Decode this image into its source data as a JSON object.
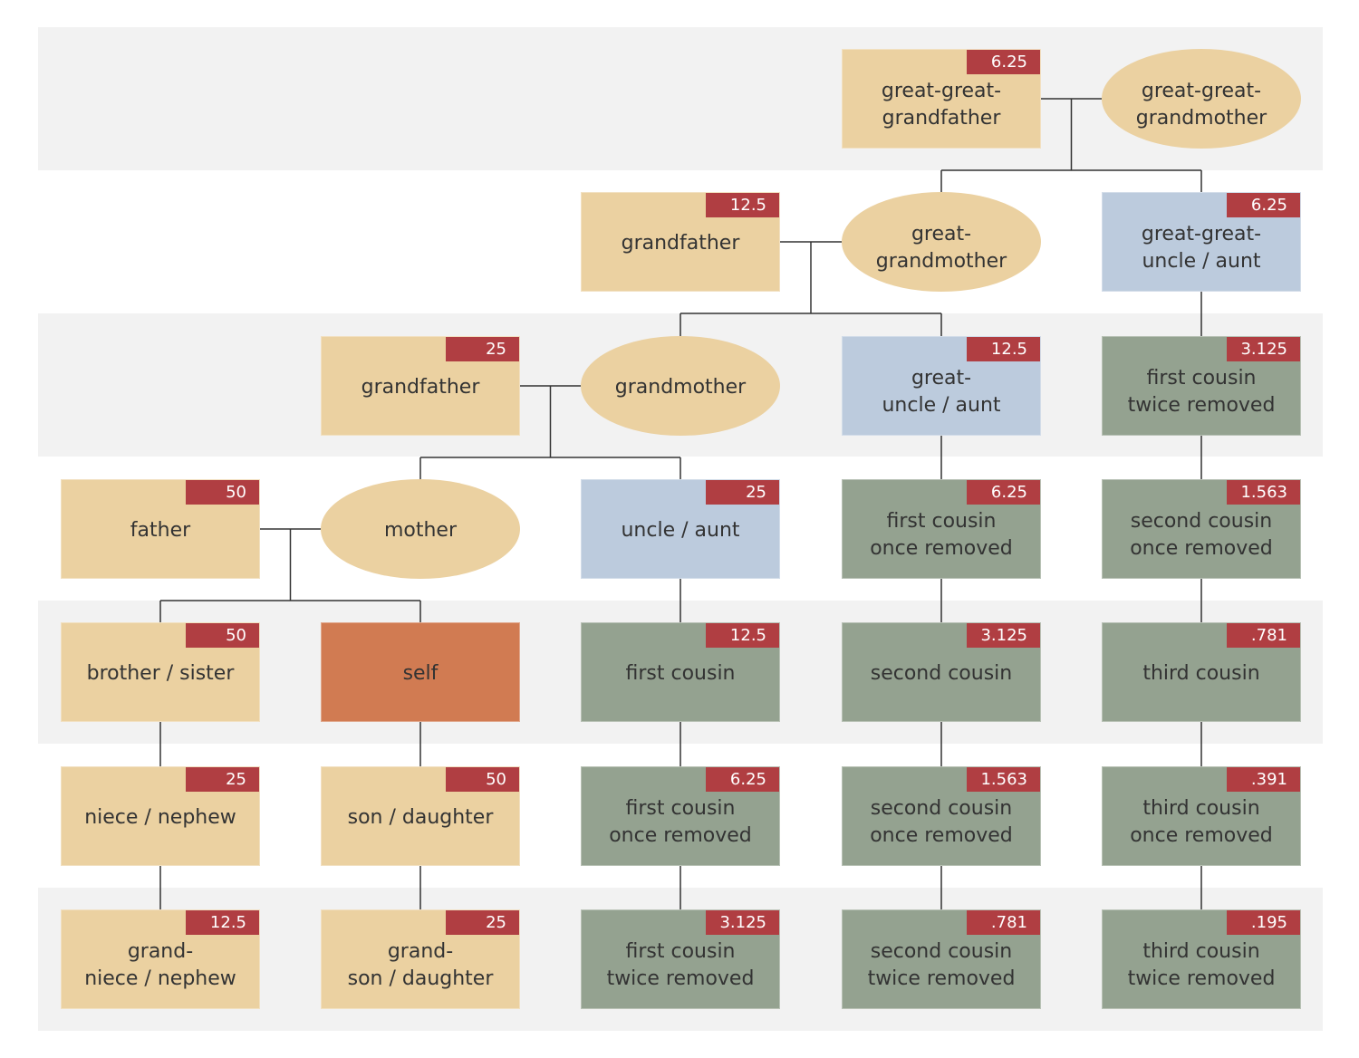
{
  "colors": {
    "ancestor": "#ebd1a1",
    "sibling_line": "#ebd1a1",
    "uncle_aunt": "#bccbdd",
    "cousin": "#94a290",
    "self": "#d17b52",
    "badge": "#b03e42",
    "band": "#f2f2f2",
    "line": "#333333"
  },
  "nodes": [
    {
      "id": "ggf",
      "label": "great-great-\ngrandfather",
      "badge": "6.25",
      "kind": "ancestor",
      "shape": "rect",
      "col": 3,
      "row": 0
    },
    {
      "id": "ggm",
      "label": "great-great-\ngrandmother",
      "badge": null,
      "kind": "ancestor",
      "shape": "ellipse",
      "col": 4,
      "row": 0
    },
    {
      "id": "gf2",
      "label": "grandfather",
      "badge": "12.5",
      "kind": "ancestor",
      "shape": "rect",
      "col": 2,
      "row": 1
    },
    {
      "id": "ggm2",
      "label": "great-\ngrandmother",
      "badge": null,
      "kind": "ancestor",
      "shape": "ellipse",
      "col": 3,
      "row": 1
    },
    {
      "id": "ggua",
      "label": "great-great-\nuncle / aunt",
      "badge": "6.25",
      "kind": "uncle_aunt",
      "shape": "rect",
      "col": 4,
      "row": 1
    },
    {
      "id": "gf",
      "label": "grandfather",
      "badge": "25",
      "kind": "ancestor",
      "shape": "rect",
      "col": 1,
      "row": 2
    },
    {
      "id": "gm",
      "label": "grandmother",
      "badge": null,
      "kind": "ancestor",
      "shape": "ellipse",
      "col": 2,
      "row": 2
    },
    {
      "id": "gua",
      "label": "great-\nuncle / aunt",
      "badge": "12.5",
      "kind": "uncle_aunt",
      "shape": "rect",
      "col": 3,
      "row": 2
    },
    {
      "id": "fc2r_a",
      "label": "first cousin\ntwice removed",
      "badge": "3.125",
      "kind": "cousin",
      "shape": "rect",
      "col": 4,
      "row": 2
    },
    {
      "id": "father",
      "label": "father",
      "badge": "50",
      "kind": "ancestor",
      "shape": "rect",
      "col": 0,
      "row": 3
    },
    {
      "id": "mother",
      "label": "mother",
      "badge": null,
      "kind": "ancestor",
      "shape": "ellipse",
      "col": 1,
      "row": 3
    },
    {
      "id": "ua",
      "label": "uncle / aunt",
      "badge": "25",
      "kind": "uncle_aunt",
      "shape": "rect",
      "col": 2,
      "row": 3
    },
    {
      "id": "fc1r_a",
      "label": "first cousin\nonce removed",
      "badge": "6.25",
      "kind": "cousin",
      "shape": "rect",
      "col": 3,
      "row": 3
    },
    {
      "id": "sc1r_a",
      "label": "second cousin\nonce removed",
      "badge": "1.563",
      "kind": "cousin",
      "shape": "rect",
      "col": 4,
      "row": 3
    },
    {
      "id": "sib",
      "label": "brother / sister",
      "badge": "50",
      "kind": "ancestor",
      "shape": "rect",
      "col": 0,
      "row": 4
    },
    {
      "id": "self",
      "label": "self",
      "badge": null,
      "kind": "self",
      "shape": "rect",
      "col": 1,
      "row": 4
    },
    {
      "id": "fc",
      "label": "first cousin",
      "badge": "12.5",
      "kind": "cousin",
      "shape": "rect",
      "col": 2,
      "row": 4
    },
    {
      "id": "sc",
      "label": "second cousin",
      "badge": "3.125",
      "kind": "cousin",
      "shape": "rect",
      "col": 3,
      "row": 4
    },
    {
      "id": "tc",
      "label": "third cousin",
      "badge": ".781",
      "kind": "cousin",
      "shape": "rect",
      "col": 4,
      "row": 4
    },
    {
      "id": "nn",
      "label": "niece / nephew",
      "badge": "25",
      "kind": "ancestor",
      "shape": "rect",
      "col": 0,
      "row": 5
    },
    {
      "id": "sd",
      "label": "son / daughter",
      "badge": "50",
      "kind": "ancestor",
      "shape": "rect",
      "col": 1,
      "row": 5
    },
    {
      "id": "fc1r_d",
      "label": "first cousin\nonce removed",
      "badge": "6.25",
      "kind": "cousin",
      "shape": "rect",
      "col": 2,
      "row": 5
    },
    {
      "id": "sc1r_d",
      "label": "second cousin\nonce removed",
      "badge": "1.563",
      "kind": "cousin",
      "shape": "rect",
      "col": 3,
      "row": 5
    },
    {
      "id": "tc1r_d",
      "label": "third cousin\nonce removed",
      "badge": ".391",
      "kind": "cousin",
      "shape": "rect",
      "col": 4,
      "row": 5
    },
    {
      "id": "gnn",
      "label": "grand-\nniece / nephew",
      "badge": "12.5",
      "kind": "ancestor",
      "shape": "rect",
      "col": 0,
      "row": 6
    },
    {
      "id": "gsd",
      "label": "grand-\nson / daughter",
      "badge": "25",
      "kind": "ancestor",
      "shape": "rect",
      "col": 1,
      "row": 6
    },
    {
      "id": "fc2r_d",
      "label": "first cousin\ntwice removed",
      "badge": "3.125",
      "kind": "cousin",
      "shape": "rect",
      "col": 2,
      "row": 6
    },
    {
      "id": "sc2r_d",
      "label": "second cousin\ntwice removed",
      "badge": ".781",
      "kind": "cousin",
      "shape": "rect",
      "col": 3,
      "row": 6
    },
    {
      "id": "tc2r_d",
      "label": "third cousin\ntwice removed",
      "badge": ".195",
      "kind": "cousin",
      "shape": "rect",
      "col": 4,
      "row": 6
    }
  ],
  "couples": [
    {
      "a": "ggf",
      "b": "ggm",
      "children": [
        "ggm2",
        "ggua"
      ]
    },
    {
      "a": "gf2",
      "b": "ggm2",
      "children": [
        "gm",
        "gua"
      ]
    },
    {
      "a": "gf",
      "b": "gm",
      "children": [
        "mother",
        "ua"
      ]
    },
    {
      "a": "father",
      "b": "mother",
      "children": [
        "sib",
        "self"
      ]
    }
  ],
  "descents": [
    [
      "ggua",
      "fc2r_a"
    ],
    [
      "fc2r_a",
      "sc1r_a"
    ],
    [
      "sc1r_a",
      "tc"
    ],
    [
      "tc",
      "tc1r_d"
    ],
    [
      "tc1r_d",
      "tc2r_d"
    ],
    [
      "gua",
      "fc1r_a"
    ],
    [
      "fc1r_a",
      "sc"
    ],
    [
      "sc",
      "sc1r_d"
    ],
    [
      "sc1r_d",
      "sc2r_d"
    ],
    [
      "ua",
      "fc"
    ],
    [
      "fc",
      "fc1r_d"
    ],
    [
      "fc1r_d",
      "fc2r_d"
    ],
    [
      "sib",
      "nn"
    ],
    [
      "nn",
      "gnn"
    ],
    [
      "self",
      "sd"
    ],
    [
      "sd",
      "gsd"
    ]
  ]
}
